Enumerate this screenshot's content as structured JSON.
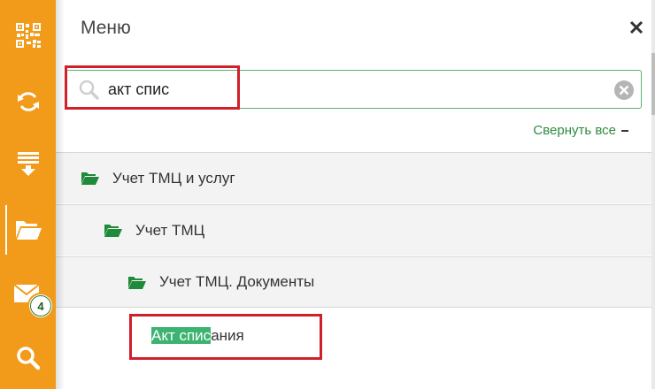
{
  "sidebar": {
    "icons": [
      "qr-code-icon",
      "sync-icon",
      "download-list-icon",
      "folder-open-icon",
      "mail-icon",
      "search-icon"
    ],
    "active": "folder-open-icon",
    "mail_badge": "4"
  },
  "panel": {
    "title": "Меню",
    "close_icon": "close-icon"
  },
  "search": {
    "value": "акт спис",
    "clear_icon": "clear-circle-icon"
  },
  "collapse_all_label": "Свернуть все",
  "tree": [
    {
      "level": 1,
      "label": "Учет ТМЦ и услуг",
      "icon": "folder-open-icon"
    },
    {
      "level": 2,
      "label": "Учет ТМЦ",
      "icon": "folder-open-icon"
    },
    {
      "level": 3,
      "label": "Учет ТМЦ. Документы",
      "icon": "folder-open-icon"
    }
  ],
  "result": {
    "match": "Акт спис",
    "rest": "ания"
  },
  "colors": {
    "rail": "#f29a1a",
    "accent_green": "#2e8b3e",
    "highlight": "#3cb371",
    "annotation_red": "#d0202a"
  }
}
